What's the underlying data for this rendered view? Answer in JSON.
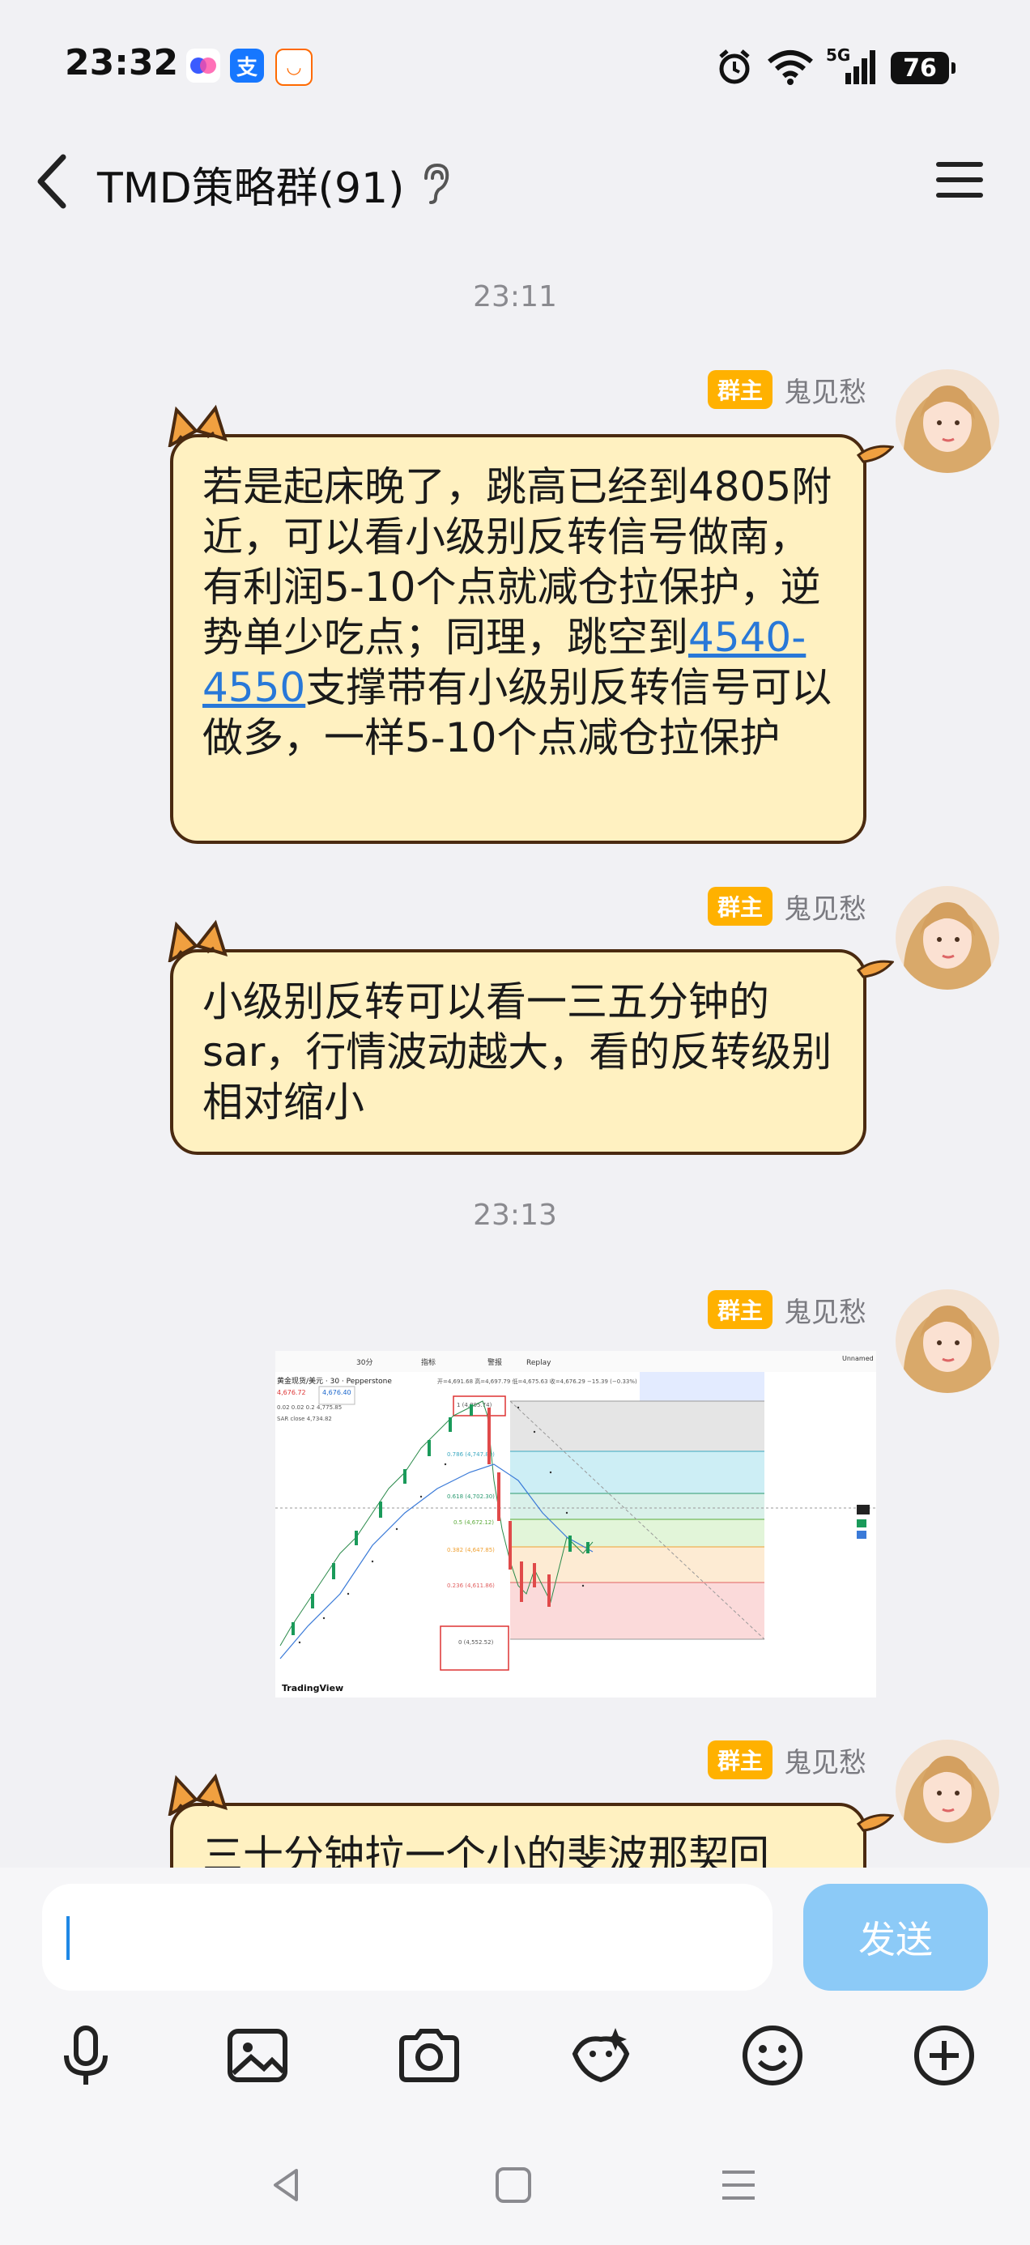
{
  "status_bar": {
    "time": "23:32",
    "network": "5G",
    "battery": "76"
  },
  "header": {
    "title": "TMD策略群(91)"
  },
  "messages": [
    {
      "timestamp": "23:11"
    },
    {
      "role": "群主",
      "sender": "鬼见愁",
      "text_before_link": "若是起床晚了，跳高已经到4805附近，可以看小级别反转信号做南，有利润5-10个点就减仓拉保护，逆势单少吃点；同理，跳空到",
      "link": "4540-4550",
      "text_after_link": "支撑带有小级别反转信号可以做多，一样5-10个点减仓拉保护"
    },
    {
      "role": "群主",
      "sender": "鬼见愁",
      "text": "小级别反转可以看一三五分钟的sar，行情波动越大，看的反转级别相对缩小"
    },
    {
      "timestamp": "23:13"
    },
    {
      "role": "群主",
      "sender": "鬼见愁",
      "image": {
        "toolbar": [
          "30分",
          "指标",
          "警报",
          "Replay"
        ],
        "symbol": "黄金现货/美元 · 30 · Pepperstone",
        "price_left": "4,676.72",
        "price_box": "4,676.40",
        "small_lines": [
          "0.02 0.02 0.2 4,775.85",
          "SAR close 4,734.82"
        ],
        "fib_levels": [
          {
            "label": "1 (4,805.74)"
          },
          {
            "label": "0.786 (4,747.89)"
          },
          {
            "label": "0.618 (4,702.30)"
          },
          {
            "label": "0.5 (4,672.12)"
          },
          {
            "label": "0.382 (4,647.85)"
          },
          {
            "label": "0.236 (4,611.86)"
          },
          {
            "label": "0 (4,552.52)"
          }
        ],
        "ohlc": "开=4,691.68 高=4,697.79 低=4,675.63 收=4,676.29 −15.39 (−0.33%)",
        "watermark": "TradingView",
        "unnamed": "Unnamed"
      }
    },
    {
      "role": "群主",
      "sender": "鬼见愁",
      "text": "三十分钟拉一个小的斐波那契回"
    }
  ],
  "composer": {
    "input_value": "",
    "send_label": "发送"
  },
  "toolbar_icons": [
    "microphone-icon",
    "image-icon",
    "camera-icon",
    "redpacket-icon",
    "emoji-icon",
    "plus-icon"
  ]
}
